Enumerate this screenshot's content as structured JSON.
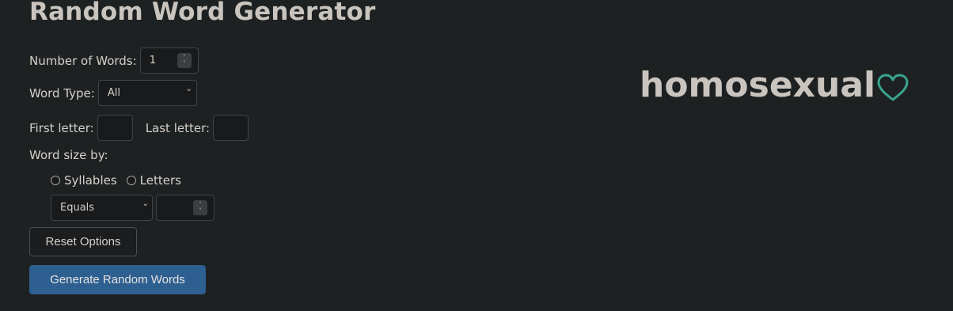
{
  "title": "Random Word Generator",
  "form": {
    "number_of_words_label": "Number of Words:",
    "number_of_words_value": "1",
    "word_type_label": "Word Type:",
    "word_type_value": "All",
    "first_letter_label": "First letter:",
    "last_letter_label": "Last letter:",
    "word_size_label": "Word size by:",
    "syllables_label": "Syllables",
    "letters_label": "Letters",
    "size_comparison_value": "Equals",
    "size_value": ""
  },
  "buttons": {
    "reset": "Reset Options",
    "generate": "Generate Random Words"
  },
  "result": {
    "word": "homosexual",
    "favorite_icon": "heart-outline-icon"
  },
  "colors": {
    "background": "#1e2122",
    "primary_button": "#2d5f91",
    "heart": "#3aa58f"
  }
}
